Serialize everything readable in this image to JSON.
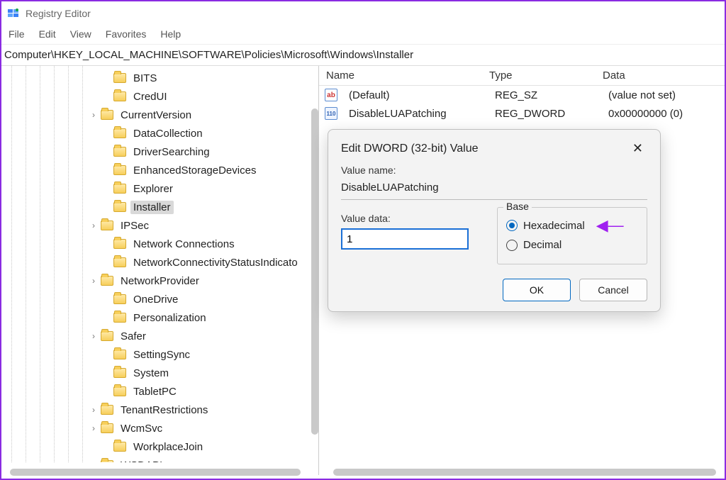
{
  "app": {
    "title": "Registry Editor"
  },
  "menu": {
    "file": "File",
    "edit": "Edit",
    "view": "View",
    "favorites": "Favorites",
    "help": "Help"
  },
  "address": "Computer\\HKEY_LOCAL_MACHINE\\SOFTWARE\\Policies\\Microsoft\\Windows\\Installer",
  "tree_items": [
    {
      "label": "BITS",
      "exp": false,
      "depth": 2
    },
    {
      "label": "CredUI",
      "exp": false,
      "depth": 2
    },
    {
      "label": "CurrentVersion",
      "exp": true,
      "depth": 1
    },
    {
      "label": "DataCollection",
      "exp": false,
      "depth": 2
    },
    {
      "label": "DriverSearching",
      "exp": false,
      "depth": 2
    },
    {
      "label": "EnhancedStorageDevices",
      "exp": false,
      "depth": 2
    },
    {
      "label": "Explorer",
      "exp": false,
      "depth": 2
    },
    {
      "label": "Installer",
      "exp": false,
      "depth": 2,
      "selected": true
    },
    {
      "label": "IPSec",
      "exp": true,
      "depth": 1
    },
    {
      "label": "Network Connections",
      "exp": false,
      "depth": 2
    },
    {
      "label": "NetworkConnectivityStatusIndicato",
      "exp": false,
      "depth": 2
    },
    {
      "label": "NetworkProvider",
      "exp": true,
      "depth": 1
    },
    {
      "label": "OneDrive",
      "exp": false,
      "depth": 2
    },
    {
      "label": "Personalization",
      "exp": false,
      "depth": 2
    },
    {
      "label": "Safer",
      "exp": true,
      "depth": 1
    },
    {
      "label": "SettingSync",
      "exp": false,
      "depth": 2
    },
    {
      "label": "System",
      "exp": false,
      "depth": 2
    },
    {
      "label": "TabletPC",
      "exp": false,
      "depth": 2
    },
    {
      "label": "TenantRestrictions",
      "exp": true,
      "depth": 1
    },
    {
      "label": "WcmSvc",
      "exp": true,
      "depth": 1
    },
    {
      "label": "WorkplaceJoin",
      "exp": false,
      "depth": 2
    },
    {
      "label": "WSDAPI",
      "exp": true,
      "depth": 1
    }
  ],
  "columns": {
    "name": "Name",
    "type": "Type",
    "data": "Data"
  },
  "values": [
    {
      "icon": "ab",
      "name": "(Default)",
      "type": "REG_SZ",
      "data": "(value not set)"
    },
    {
      "icon": "dw",
      "name": "DisableLUAPatching",
      "type": "REG_DWORD",
      "data": "0x00000000 (0)"
    }
  ],
  "dialog": {
    "title": "Edit DWORD (32-bit) Value",
    "value_name_label": "Value name:",
    "value_name": "DisableLUAPatching",
    "value_data_label": "Value data:",
    "value_data": "1",
    "base_label": "Base",
    "hex_label": "Hexadecimal",
    "dec_label": "Decimal",
    "ok": "OK",
    "cancel": "Cancel"
  }
}
